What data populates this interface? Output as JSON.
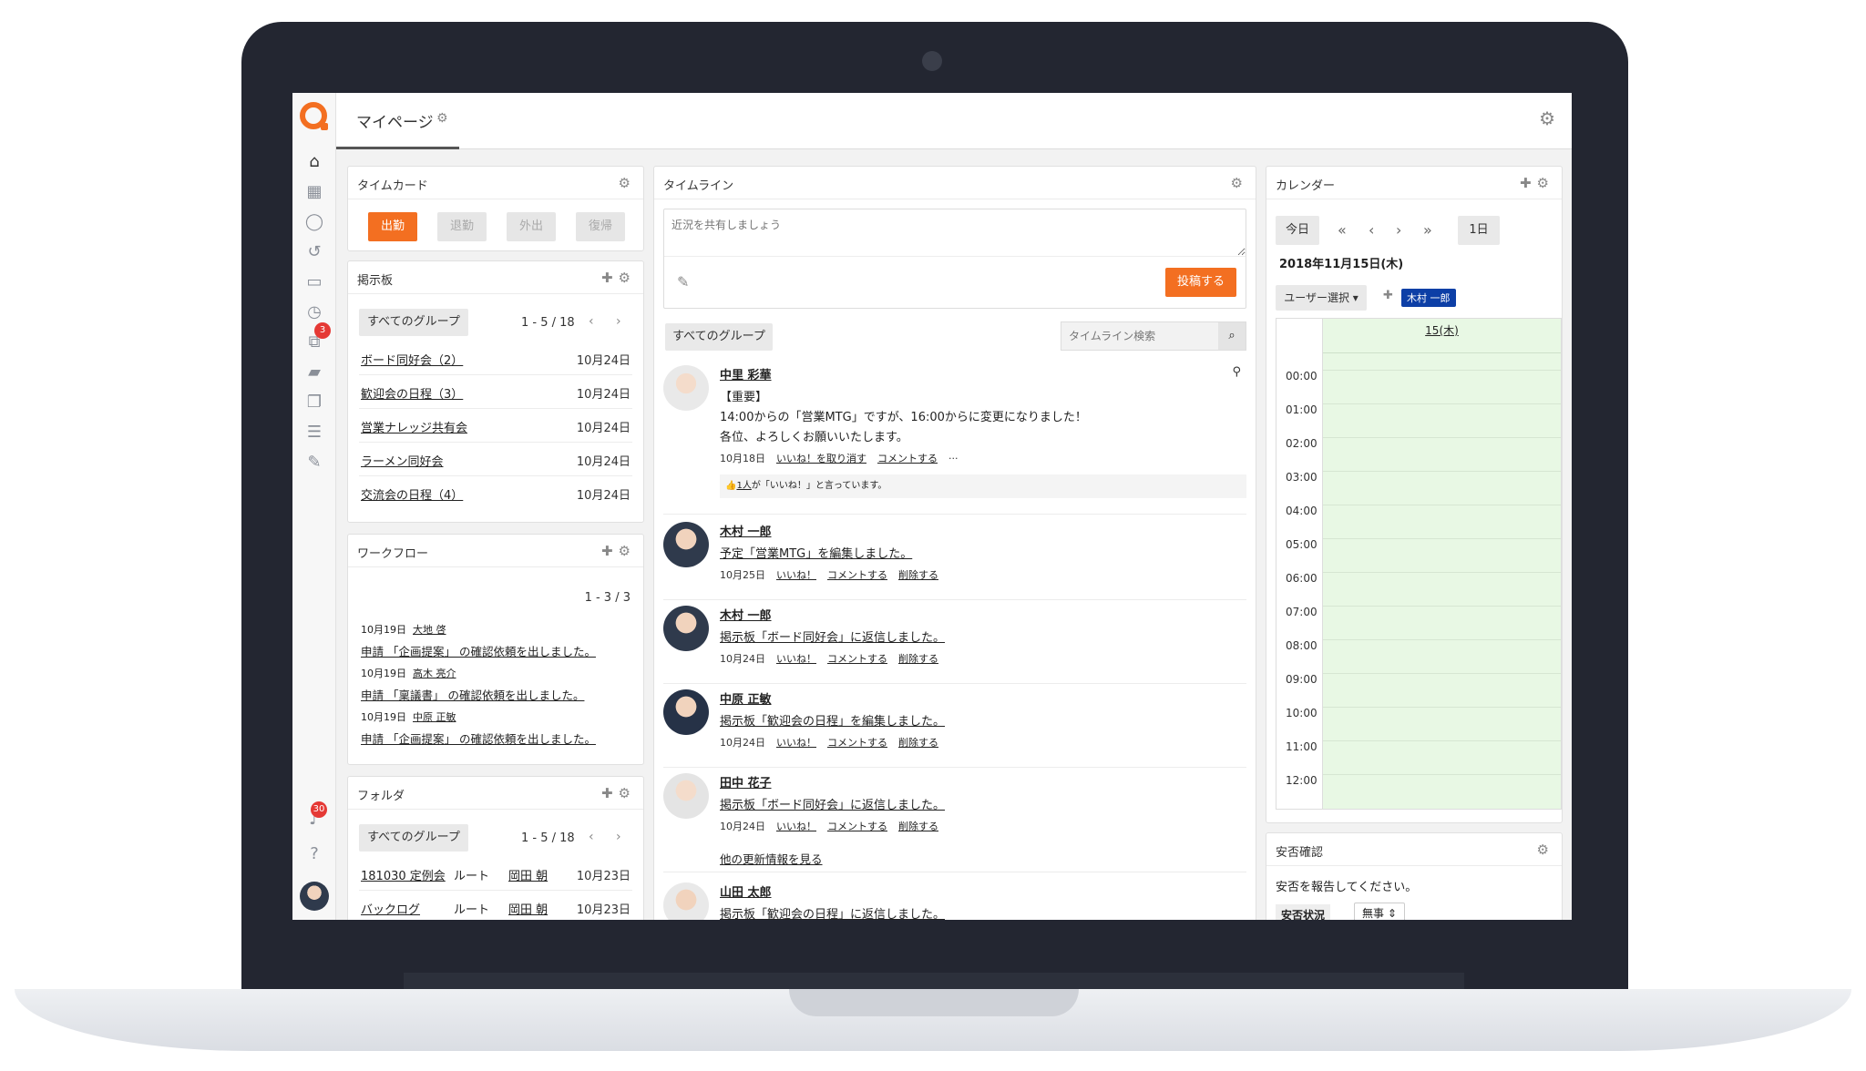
{
  "header": {
    "title": "マイページ"
  },
  "sidebar": {
    "badge_count": "3",
    "notification_count": "30"
  },
  "timecard": {
    "title": "タイムカード",
    "buttons": [
      "出勤",
      "退勤",
      "外出",
      "復帰"
    ]
  },
  "board": {
    "title": "掲示板",
    "group_filter": "すべてのグループ",
    "pager": "1 - 5 / 18",
    "items": [
      {
        "name": "ボード同好会（2）",
        "date": "10月24日"
      },
      {
        "name": "歓迎会の日程（3）",
        "date": "10月24日"
      },
      {
        "name": "営業ナレッジ共有会",
        "date": "10月24日"
      },
      {
        "name": "ラーメン同好会",
        "date": "10月24日"
      },
      {
        "name": "交流会の日程（4）",
        "date": "10月24日"
      }
    ]
  },
  "workflow": {
    "title": "ワークフロー",
    "pager": "1 - 3 / 3",
    "items": [
      {
        "date": "10月19日",
        "user": "大地 啓",
        "text": "申請 「企画提案」 の確認依頼を出しました。"
      },
      {
        "date": "10月19日",
        "user": "高木 亮介",
        "text": "申請 「稟議書」 の確認依頼を出しました。"
      },
      {
        "date": "10月19日",
        "user": "中原 正敏",
        "text": "申請 「企画提案」 の確認依頼を出しました。"
      }
    ]
  },
  "folder": {
    "title": "フォルダ",
    "group_filter": "すべてのグループ",
    "pager": "1 - 5 / 18",
    "items": [
      {
        "name": "181030 定例会",
        "location": "ルート",
        "user": "岡田 朝",
        "date": "10月23日"
      },
      {
        "name": "バックログ",
        "location": "ルート",
        "user": "岡田 朝",
        "date": "10月23日"
      }
    ]
  },
  "timeline": {
    "title": "タイムライン",
    "placeholder": "近況を共有しましょう",
    "post_button": "投稿する",
    "group_filter": "すべてのグループ",
    "search_placeholder": "タイムライン検索",
    "more_link": "他の更新情報を見る",
    "entries": [
      {
        "name": "中里 彩華",
        "lines": [
          "【重要】",
          "14:00からの「営業MTG」ですが、16:00からに変更になりました！",
          "各位、よろしくお願いいたします。"
        ],
        "date": "10月18日",
        "like": "いいね！を取り消す",
        "comment": "コメントする",
        "likes_prefix": "1人",
        "likes_suffix": "が「いいね！」と言っています。"
      },
      {
        "name": "木村 一郎",
        "text": "予定「営業MTG」を編集しました。",
        "date": "10月25日",
        "like": "いいね！",
        "comment": "コメントする",
        "delete": "削除する"
      },
      {
        "name": "木村 一郎",
        "text": "掲示板「ボード同好会」に返信しました。",
        "date": "10月24日",
        "like": "いいね！",
        "comment": "コメントする",
        "delete": "削除する"
      },
      {
        "name": "中原 正敏",
        "text": "掲示板「歓迎会の日程」を編集しました。",
        "date": "10月24日",
        "like": "いいね！",
        "comment": "コメントする",
        "delete": "削除する"
      },
      {
        "name": "田中 花子",
        "text": "掲示板「ボード同好会」に返信しました。",
        "date": "10月24日",
        "like": "いいね！",
        "comment": "コメントする",
        "delete": "削除する"
      },
      {
        "name": "山田 太郎",
        "text": "掲示板「歓迎会の日程」に返信しました。"
      }
    ]
  },
  "calendar": {
    "title": "カレンダー",
    "today": "今日",
    "view": "1日",
    "date_label": "2018年11月15日(木)",
    "user_select": "ユーザー選択",
    "user_tag": "木村 一郎",
    "day_header": "15(木)",
    "hours": [
      "00:00",
      "01:00",
      "02:00",
      "03:00",
      "04:00",
      "05:00",
      "06:00",
      "07:00",
      "08:00",
      "09:00",
      "10:00",
      "11:00",
      "12:00"
    ]
  },
  "safety": {
    "title": "安否確認",
    "message": "安否を報告してください。",
    "status_label": "安否状況",
    "status_value": "無事"
  },
  "colors": {
    "accent": "#f36f21",
    "calendar_bg": "#e8f8e4",
    "tag_blue": "#0d3fa6"
  }
}
